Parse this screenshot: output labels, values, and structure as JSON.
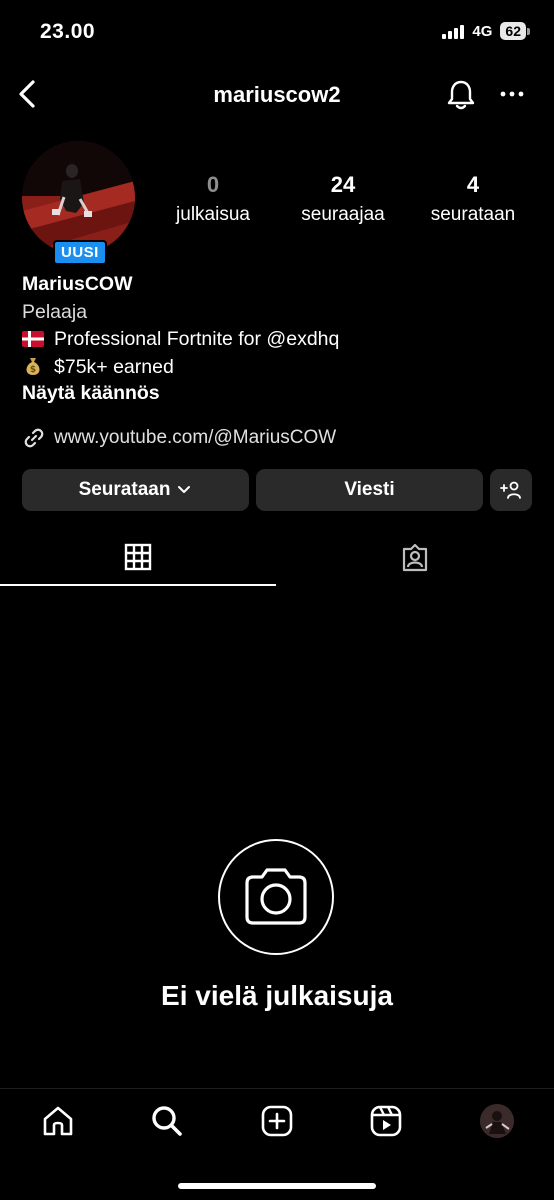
{
  "status_bar": {
    "time": "23.00",
    "network": "4G",
    "battery": "62"
  },
  "header": {
    "username": "mariuscow2"
  },
  "avatar": {
    "badge": "UUSI"
  },
  "stats": [
    {
      "value": "0",
      "label": "julkaisua"
    },
    {
      "value": "24",
      "label": "seuraajaa"
    },
    {
      "value": "4",
      "label": "seurataan"
    }
  ],
  "bio": {
    "name": "MariusCOW",
    "category": "Pelaaja",
    "line1": "Professional Fortnite for @exdhq",
    "line2": "$75k+ earned",
    "translate": "Näytä käännös",
    "link": "www.youtube.com/@MariusCOW"
  },
  "buttons": {
    "following": "Seurataan",
    "message": "Viesti"
  },
  "empty_state": {
    "text": "Ei vielä julkaisuja"
  },
  "colors": {
    "background": "#000000",
    "button": "#2a2a2a",
    "badge": "#1b8ff0",
    "muted": "#8e8e8e"
  },
  "icons": [
    "back-icon",
    "bell-icon",
    "more-icon",
    "grid-icon",
    "tagged-icon",
    "camera-icon",
    "home-icon",
    "search-icon",
    "create-icon",
    "reels-icon",
    "profile-avatar-icon",
    "link-icon",
    "chevron-down-icon",
    "add-person-icon"
  ]
}
